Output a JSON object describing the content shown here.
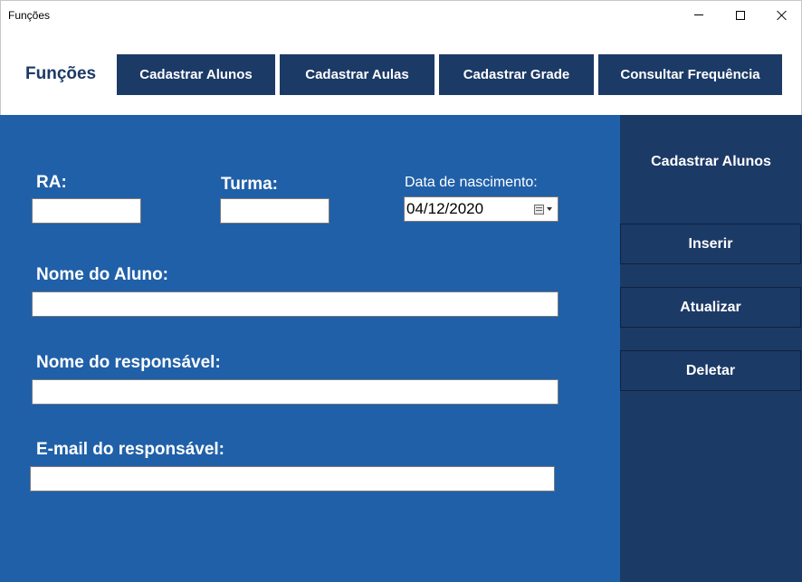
{
  "window": {
    "title": "Funções"
  },
  "nav": {
    "brand": "Funções",
    "items": [
      {
        "label": "Cadastrar Alunos"
      },
      {
        "label": "Cadastrar Aulas"
      },
      {
        "label": "Cadastrar Grade"
      },
      {
        "label": "Consultar Frequência"
      }
    ]
  },
  "form": {
    "ra_label": "RA:",
    "ra_value": "",
    "turma_label": "Turma:",
    "turma_value": "",
    "nascimento_label": "Data de nascimento:",
    "nascimento_value": "04/12/2020",
    "nome_aluno_label": "Nome do Aluno:",
    "nome_aluno_value": "",
    "nome_responsavel_label": "Nome do responsável:",
    "nome_responsavel_value": "",
    "email_responsavel_label": "E-mail do responsável:",
    "email_responsavel_value": ""
  },
  "side": {
    "title": "Cadastrar Alunos",
    "buttons": [
      {
        "label": "Inserir"
      },
      {
        "label": "Atualizar"
      },
      {
        "label": "Deletar"
      }
    ]
  },
  "colors": {
    "navy": "#1c3a66",
    "main_blue": "#2060a8"
  }
}
